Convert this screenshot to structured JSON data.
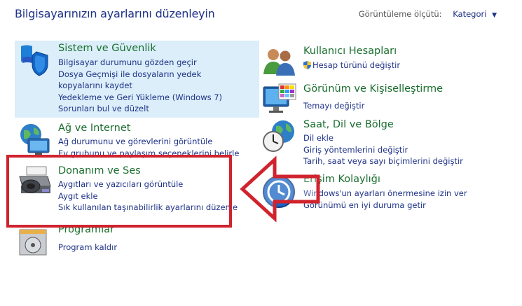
{
  "header": {
    "title": "Bilgisayarınızın ayarlarını düzenleyin",
    "view_by_label": "Görüntüleme ölçütü:",
    "view_by_value": "Kategori",
    "arrow_icon": "caret-down-icon"
  },
  "left": [
    {
      "title": "Sistem ve Güvenlik",
      "links": [
        "Bilgisayar durumunu gözden geçir",
        "Dosya Geçmişi ile dosyaların yedek kopyalarını kaydet",
        "Yedekleme ve Geri Yükleme (Windows 7)",
        "Sorunları bul ve düzelt"
      ],
      "icon": "shield-flag-icon"
    },
    {
      "title": "Ağ ve Internet",
      "links": [
        "Ağ durumunu ve görevlerini görüntüle",
        "Ev grubunu ve paylaşım seçeneklerini belirle"
      ],
      "icon": "network-globe-icon"
    },
    {
      "title": "Donanım ve Ses",
      "links": [
        "Aygıtları ve yazıcıları görüntüle",
        "Aygıt ekle",
        "Sık kullanılan taşınabilirlik ayarlarını düzenle"
      ],
      "icon": "printer-speaker-icon"
    },
    {
      "title": "Programlar",
      "links": [
        "Program kaldır"
      ],
      "icon": "programs-disc-icon"
    }
  ],
  "right": [
    {
      "title": "Kullanıcı Hesapları",
      "links": [
        "Hesap türünü değiştir"
      ],
      "icon": "users-icon"
    },
    {
      "title": "Görünüm ve Kişiselleştirme",
      "links": [
        "Temayı değiştir"
      ],
      "icon": "monitor-palette-icon"
    },
    {
      "title": "Saat, Dil ve Bölge",
      "links": [
        "Dil ekle",
        "Giriş yöntemlerini değiştir",
        "Tarih, saat veya sayı biçimlerini değiştir"
      ],
      "icon": "clock-globe-icon"
    },
    {
      "title": "Erişim Kolaylığı",
      "links": [
        "Windows'un ayarları önermesine izin ver",
        "Görünümü en iyi duruma getir"
      ],
      "icon": "ease-of-access-icon"
    }
  ],
  "annotation": {
    "color": "#d0232e"
  },
  "colors": {
    "link": "#1e3287",
    "title": "#1a6e2e",
    "highlight": "#dbeef9"
  }
}
